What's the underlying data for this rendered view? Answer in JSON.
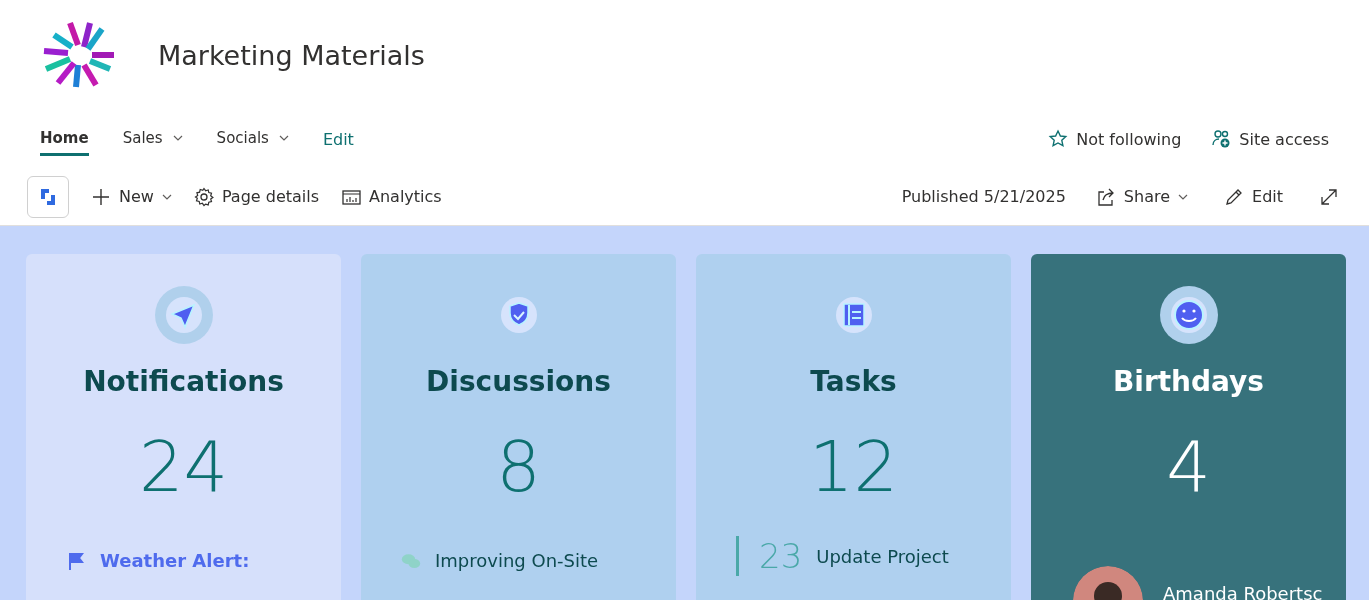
{
  "site": {
    "title": "Marketing Materials"
  },
  "nav": [
    {
      "label": "Home",
      "selected": true,
      "dropdown": false
    },
    {
      "label": "Sales",
      "selected": false,
      "dropdown": true
    },
    {
      "label": "Socials",
      "selected": false,
      "dropdown": true
    }
  ],
  "nav_edit": "Edit",
  "site_actions": [
    {
      "kind": "star",
      "label": "Not following"
    },
    {
      "kind": "people",
      "label": "Site access"
    }
  ],
  "toolbar": [
    {
      "kind": "new",
      "label": "New",
      "dropdown": true
    },
    {
      "kind": "gear",
      "label": "Page details",
      "dropdown": false
    },
    {
      "kind": "chart",
      "label": "Analytics",
      "dropdown": false
    }
  ],
  "published": "Published 5/21/2025",
  "toolbar_right": [
    {
      "kind": "share",
      "label": "Share",
      "dropdown": true
    },
    {
      "kind": "pencil",
      "label": "Edit",
      "dropdown": false
    }
  ],
  "cards": [
    {
      "title": "Notifications",
      "count": "24",
      "kind": "send",
      "color": "#d6e0fb",
      "preview": {
        "kind": "flag",
        "text": "Weather Alert:"
      }
    },
    {
      "title": "Discussions",
      "count": "8",
      "kind": "shield",
      "color": "#afd0ef",
      "preview": {
        "kind": "chat",
        "text": "Improving On-Site"
      }
    },
    {
      "title": "Tasks",
      "count": "12",
      "kind": "list",
      "color": "#afd0ef",
      "preview": {
        "kind": "task",
        "number": "23",
        "text": "Update Project"
      }
    },
    {
      "title": "Birthdays",
      "count": "4",
      "kind": "smile",
      "color": "#37727c",
      "preview": {
        "kind": "person",
        "text": "Amanda Robertsc"
      }
    }
  ]
}
